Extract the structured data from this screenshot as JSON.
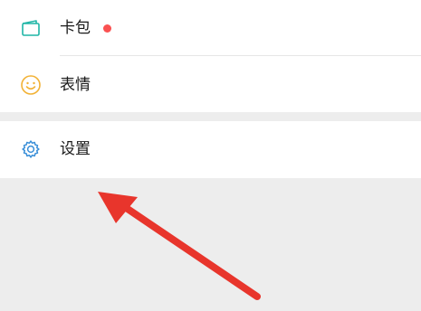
{
  "menu": {
    "cards": {
      "label": "卡包",
      "icon": "card-wallet-icon",
      "has_red_dot": true,
      "accent": "#1fb5a6"
    },
    "stickers": {
      "label": "表情",
      "icon": "smiley-face-icon",
      "accent": "#f2b236"
    },
    "settings": {
      "label": "设置",
      "icon": "gear-icon",
      "accent": "#3a8fd8"
    }
  },
  "annotation": {
    "type": "arrow",
    "color": "#e8352c"
  },
  "colors": {
    "page_bg": "#ededed",
    "row_bg": "#ffffff",
    "badge": "#fa5151"
  }
}
